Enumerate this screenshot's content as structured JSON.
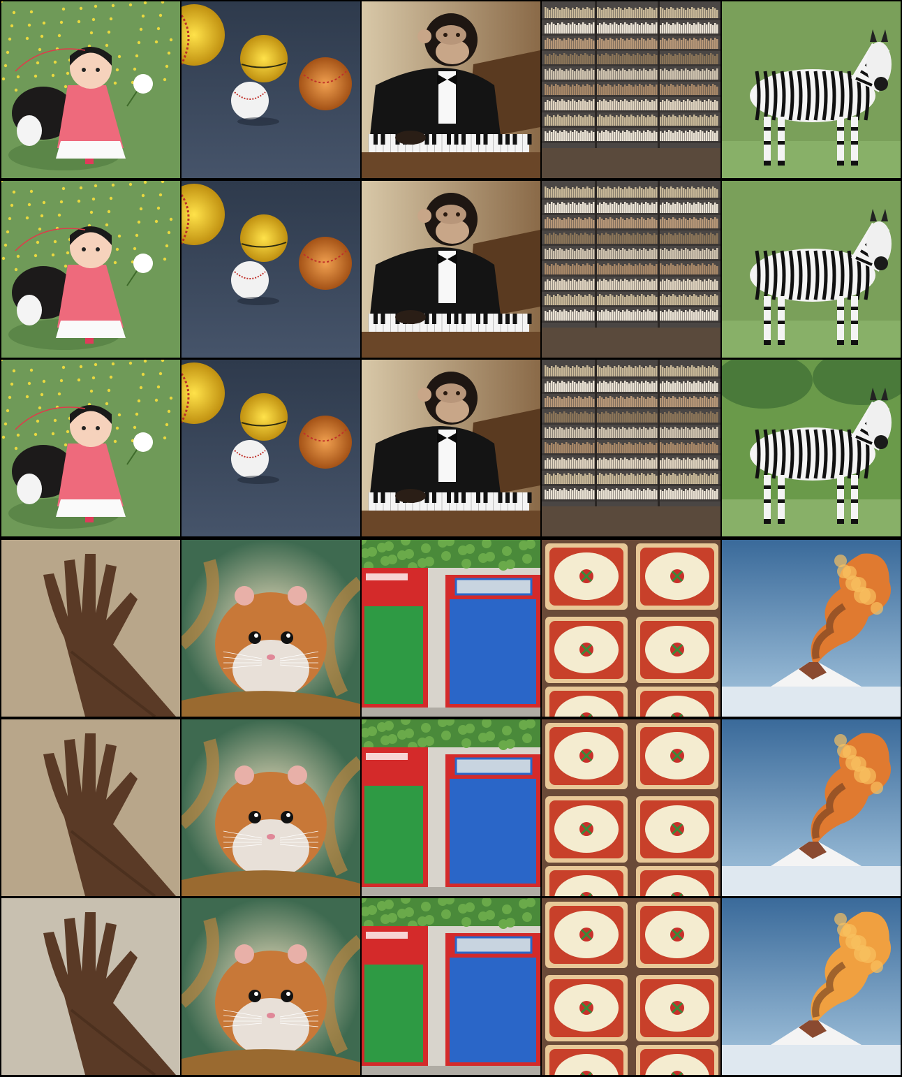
{
  "grid": {
    "columns_per_block": 5,
    "rows_per_block": 3,
    "blocks": [
      {
        "id": "top",
        "subjects": [
          "girl-with-dog-in-flower-field",
          "baseballs-and-yellow-ball",
          "chimpanzee-in-tuxedo-at-piano",
          "library-bookshelves",
          "zebra-on-grass"
        ],
        "variants": [
          "row-1",
          "row-2",
          "row-3"
        ]
      },
      {
        "id": "bottom",
        "subjects": [
          "raised-hand",
          "hamster-illustration",
          "red-and-blue-cabinets",
          "square-pizzas",
          "volcano-eruption"
        ],
        "variants": [
          "row-1",
          "row-2",
          "row-3"
        ]
      }
    ]
  },
  "colors": {
    "background": "#000000",
    "grass": "#6f9a58",
    "pizza_sauce": "#c8402a",
    "cabinet_red": "#d42a2a",
    "cabinet_blue": "#2a66c8",
    "cabinet_green": "#2e9a44",
    "sky_blue": "#5a8cc0",
    "fire_orange": "#e07a30"
  }
}
